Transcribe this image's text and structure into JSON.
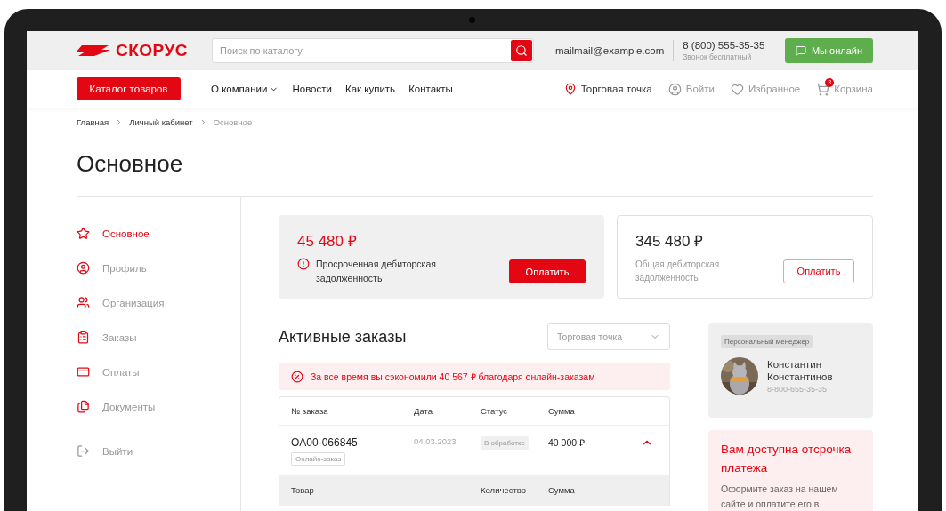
{
  "header": {
    "logo": "СКОРУС",
    "search": {
      "placeholder": "Поиск по каталогу"
    },
    "email": "mailmail@example.com",
    "phone": "8 (800) 555-35-35",
    "phone_note": "Звонок бесплатный",
    "chat_button": "Мы онлайн"
  },
  "nav": {
    "catalog_button": "Каталог товаров",
    "links": [
      {
        "label": "О компании",
        "dropdown": true
      },
      {
        "label": "Новости",
        "dropdown": false
      },
      {
        "label": "Как купить",
        "dropdown": false
      },
      {
        "label": "Контакты",
        "dropdown": false
      }
    ],
    "store": "Торговая точка",
    "login": "Войти",
    "favorites": "Избранное",
    "cart": {
      "label": "Корзина",
      "count": "3"
    }
  },
  "breadcrumbs": [
    {
      "label": "Главная",
      "current": false
    },
    {
      "label": "Личный кабинет",
      "current": false
    },
    {
      "label": "Основное",
      "current": true
    }
  ],
  "page_title": "Основное",
  "sidebar": {
    "items": [
      {
        "label": "Основное",
        "selected": true,
        "kind": "section"
      },
      {
        "label": "Профиль",
        "selected": false,
        "kind": "section"
      },
      {
        "label": "Организация",
        "selected": false,
        "kind": "section"
      },
      {
        "label": "Заказы",
        "selected": false,
        "kind": "section"
      },
      {
        "label": "Оплаты",
        "selected": false,
        "kind": "section"
      },
      {
        "label": "Документы",
        "selected": false,
        "kind": "section"
      },
      {
        "label": "Выйти",
        "selected": false,
        "kind": "logout"
      }
    ]
  },
  "balance_cards": [
    {
      "kind": "overdue",
      "amount": "45 480 ₽",
      "label": "Просроченная дебиторская задолженность",
      "button": "Оплатить"
    },
    {
      "kind": "total",
      "amount": "345 480 ₽",
      "label": "Общая дебиторская задолженность",
      "button": "Оплатить"
    }
  ],
  "orders": {
    "title": "Активные заказы",
    "store_select": {
      "placeholder": "Торговая точка"
    },
    "savings_notice": "За все время вы сэкономили 40 567 ₽ благодаря онлайн-заказам",
    "columns": [
      "№ заказа",
      "Дата",
      "Статус",
      "Сумма"
    ],
    "rows": [
      {
        "number": "OA00-066845",
        "tag": "Онлайн-заказ",
        "date": "04.03.2023",
        "status": "В обработке",
        "sum": "40 000 ₽",
        "expanded": true,
        "item_columns": [
          "Товар",
          "Количество",
          "Сумма"
        ]
      }
    ]
  },
  "manager": {
    "badge": "Персональный менеджер",
    "name": "Константин Константинов",
    "phone": "8-800-655-35-35"
  },
  "promo": {
    "title": "Вам доступна отсрочка платежа",
    "text": "Оформите заказ на нашем сайте и оплатите его в"
  }
}
